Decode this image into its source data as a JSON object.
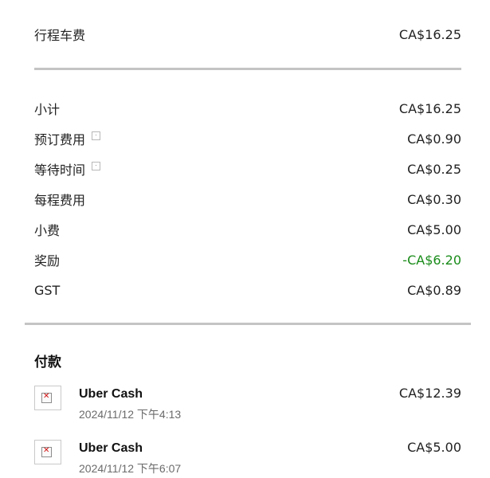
{
  "ride_fare": {
    "label": "行程车费",
    "amount": "CA$16.25"
  },
  "breakdown": [
    {
      "label": "小计",
      "amount": "CA$16.25",
      "info": false
    },
    {
      "label": "预订费用",
      "amount": "CA$0.90",
      "info": true
    },
    {
      "label": "等待时间",
      "amount": "CA$0.25",
      "info": true
    },
    {
      "label": "每程费用",
      "amount": "CA$0.30",
      "info": false
    },
    {
      "label": "小费",
      "amount": "CA$5.00",
      "info": false
    },
    {
      "label": "奖励",
      "amount": "-CA$6.20",
      "info": false,
      "credit": true
    },
    {
      "label": "GST",
      "amount": "CA$0.89",
      "info": false
    }
  ],
  "payments": {
    "title": "付款",
    "items": [
      {
        "method": "Uber Cash",
        "datetime": "2024/11/12 下午4:13",
        "amount": "CA$12.39"
      },
      {
        "method": "Uber Cash",
        "datetime": "2024/11/12 下午6:07",
        "amount": "CA$5.00"
      }
    ]
  },
  "colors": {
    "credit": "#1a8c1a",
    "divider": "#c4c4c4"
  }
}
